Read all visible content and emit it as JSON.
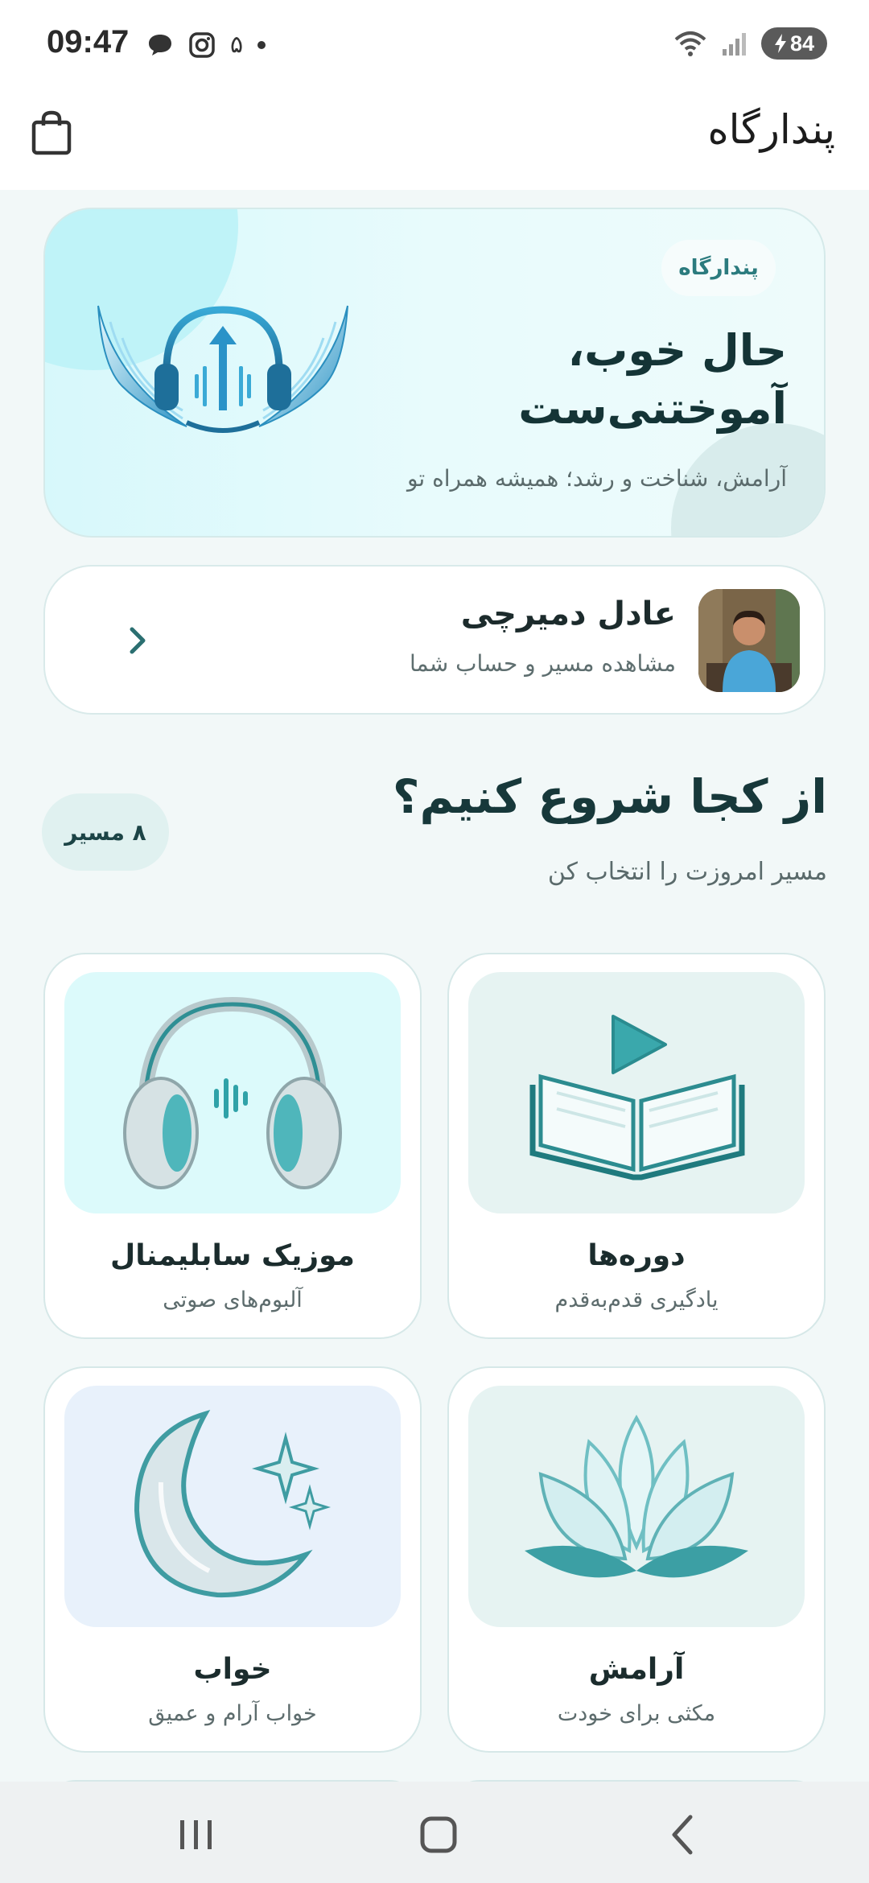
{
  "status_bar": {
    "time": "09:47",
    "notification_count": "۵",
    "battery": "84",
    "icons": [
      "chat-icon",
      "instagram-icon",
      "dot-icon",
      "wifi-icon",
      "signal-icon",
      "battery-charging-icon"
    ]
  },
  "header": {
    "title": "پندارگاه",
    "cart_icon": "shopping-bag-icon"
  },
  "hero": {
    "chip": "پندارگاه",
    "title_line1": "حال خوب،",
    "title_line2": "آموختنی‌ست",
    "subtitle": "آرامش، شناخت و رشد؛ همیشه همراه تو",
    "logo": "winged-headphones-logo"
  },
  "profile": {
    "name": "عادل دمیرچی",
    "subtitle": "مشاهده مسیر و حساب شما"
  },
  "section": {
    "title": "از کجا شروع کنیم؟",
    "subtitle": "مسیر امروزت را انتخاب کن",
    "badge": "۸ مسیر"
  },
  "categories": [
    {
      "label": "دوره‌ها",
      "desc": "یادگیری قدم‌به‌قدم",
      "icon": "open-book-play-icon"
    },
    {
      "label": "موزیک سابلیمنال",
      "desc": "آلبوم‌های صوتی",
      "icon": "headphones-icon"
    },
    {
      "label": "آرامش",
      "desc": "مکثی برای خودت",
      "icon": "lotus-icon"
    },
    {
      "label": "خواب",
      "desc": "خواب آرام و عمیق",
      "icon": "moon-stars-icon"
    }
  ],
  "colors": {
    "accent": "#2b7b7e",
    "background": "#f2f8f8",
    "hero_bg": "#d7f8fb"
  },
  "nav": {
    "icons": [
      "recents-icon",
      "home-icon",
      "back-icon"
    ]
  }
}
